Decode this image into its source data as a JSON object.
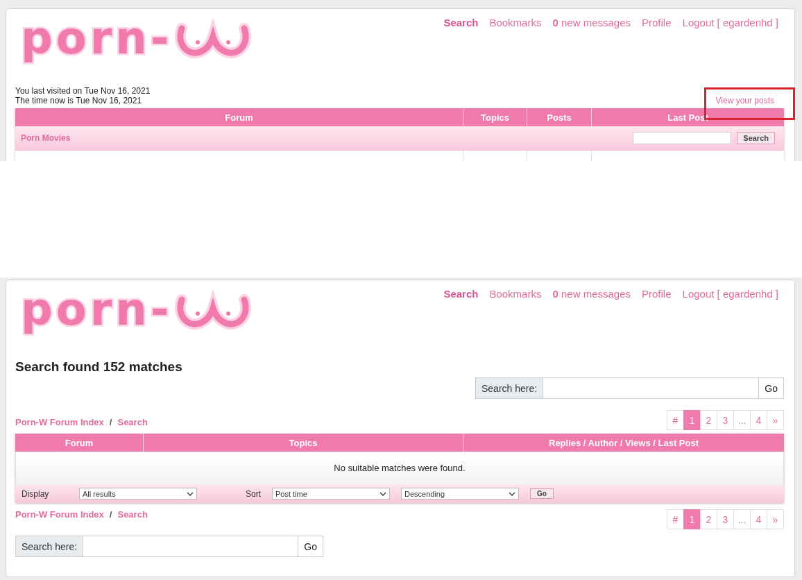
{
  "first_view": {
    "logo": {
      "text": "porn-"
    },
    "nav": [
      {
        "label": "Search",
        "selected": true
      },
      {
        "label": "Bookmarks",
        "selected": false
      },
      {
        "label": "**0** new messages",
        "selected": false
      },
      {
        "label": "Profile",
        "selected": false
      },
      {
        "label": "Logout [ egardenhd ]",
        "selected": false
      }
    ],
    "visit_info": [
      "You last visited on Tue Nov 16, 2021",
      "The time now is Tue Nov 16, 2021"
    ],
    "view_posts_link": {
      "label": "View your posts",
      "highlighted": true
    },
    "table": {
      "columns": [
        "Forum",
        "Topics",
        "Posts",
        "Last Post"
      ],
      "category": {
        "name": "Porn Movies",
        "search_button": "Search"
      }
    }
  },
  "second_view": {
    "logo": {
      "text": "porn-"
    },
    "nav": [
      {
        "label": "Search",
        "selected": true
      },
      {
        "label": "Bookmarks",
        "selected": false
      },
      {
        "label": "**0** new messages",
        "selected": false
      },
      {
        "label": "Profile",
        "selected": false
      },
      {
        "label": "Logout [ egardenhd ]",
        "selected": false
      }
    ],
    "heading": "Search found 152 matches",
    "search_box": {
      "label": "Search here:",
      "button": "Go"
    },
    "breadcrumb": {
      "items": [
        "Porn-W Forum Index",
        "Search"
      ],
      "separator": "/"
    },
    "pagination": [
      {
        "label": "#",
        "selected": false
      },
      {
        "label": "1",
        "selected": true
      },
      {
        "label": "2",
        "selected": false
      },
      {
        "label": "3",
        "selected": false
      },
      {
        "label": "...",
        "selected": false
      },
      {
        "label": "4",
        "selected": false
      },
      {
        "label": "»",
        "selected": false
      }
    ],
    "table": {
      "columns": [
        "Forum",
        "Topics",
        "Replies / Author / Views / Last Post"
      ],
      "empty_message": "No suitable matches were found.",
      "footer": {
        "display_label": "Display",
        "display_value": "All results",
        "sort_label": "Sort",
        "sort_value": "Post time",
        "order_value": "Descending",
        "button": "Go"
      }
    },
    "breadcrumb_bottom": {
      "items": [
        "Porn-W Forum Index",
        "Search"
      ],
      "separator": "/"
    },
    "pagination_bottom": [
      {
        "label": "#",
        "selected": false
      },
      {
        "label": "1",
        "selected": true
      },
      {
        "label": "2",
        "selected": false
      },
      {
        "label": "3",
        "selected": false
      },
      {
        "label": "...",
        "selected": false
      },
      {
        "label": "4",
        "selected": false
      },
      {
        "label": "»",
        "selected": false
      }
    ],
    "search_box_bottom": {
      "label": "Search here:",
      "button": "Go"
    }
  }
}
